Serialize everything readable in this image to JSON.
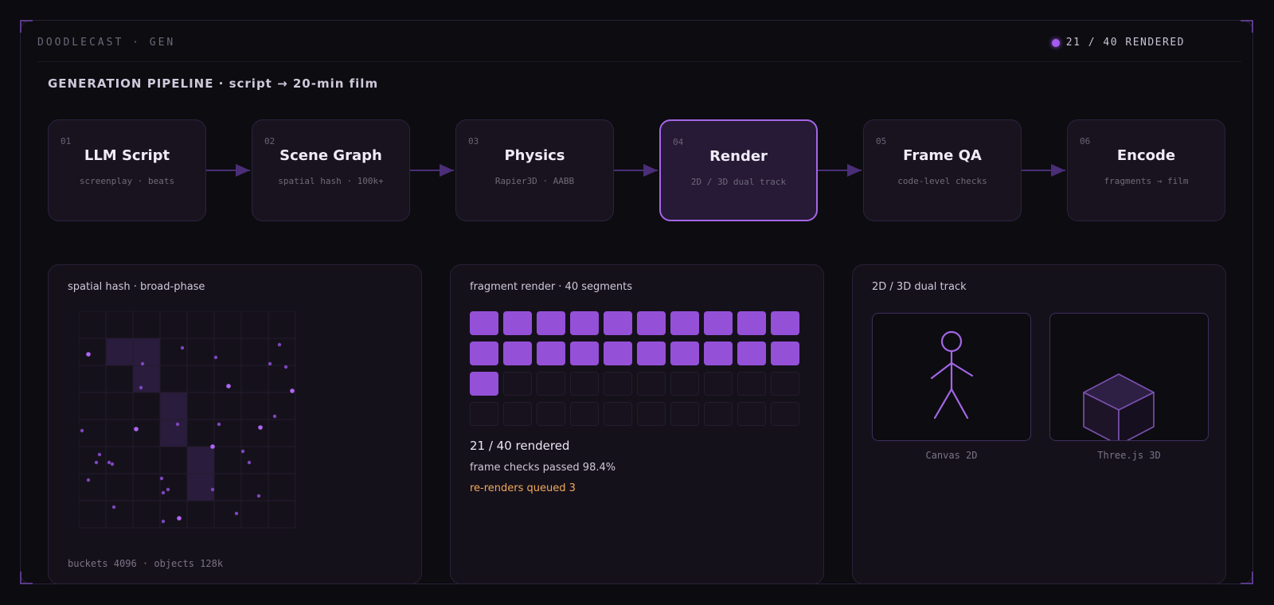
{
  "header": {
    "brand": "DOODLECAST · GEN",
    "status": "21 / 40 RENDERED",
    "status_color": "#a35cf0"
  },
  "pipeline": {
    "title": "GENERATION PIPELINE · script → 20-min film",
    "active_stage": "04",
    "stages": [
      {
        "num": "01",
        "name": "LLM Script",
        "sub": "screenplay · beats"
      },
      {
        "num": "02",
        "name": "Scene Graph",
        "sub": "spatial hash · 100k+"
      },
      {
        "num": "03",
        "name": "Physics",
        "sub": "Rapier3D · AABB"
      },
      {
        "num": "04",
        "name": "Render",
        "sub": "2D / 3D dual track"
      },
      {
        "num": "05",
        "name": "Frame QA",
        "sub": "code-level checks"
      },
      {
        "num": "06",
        "name": "Encode",
        "sub": "fragments → film"
      }
    ]
  },
  "spatial_hash": {
    "title": "spatial hash · broad-phase",
    "footer": "buckets 4096 · objects 128k",
    "grid_cells": 8,
    "highlight_color": "#2a1c3d"
  },
  "fragments": {
    "title": "fragment render · 40 segments",
    "total": 40,
    "rendered": 21,
    "rendered_label": "21 / 40 rendered",
    "checks_label": "frame checks passed 98.4%",
    "queued_label": "re-renders queued 3",
    "done_color": "#9550d8",
    "warn_color": "#f0a95a"
  },
  "dual_track": {
    "title": "2D / 3D dual track",
    "left_label": "Canvas 2D",
    "right_label": "Three.js 3D",
    "stroke_color": "#a466e6"
  }
}
